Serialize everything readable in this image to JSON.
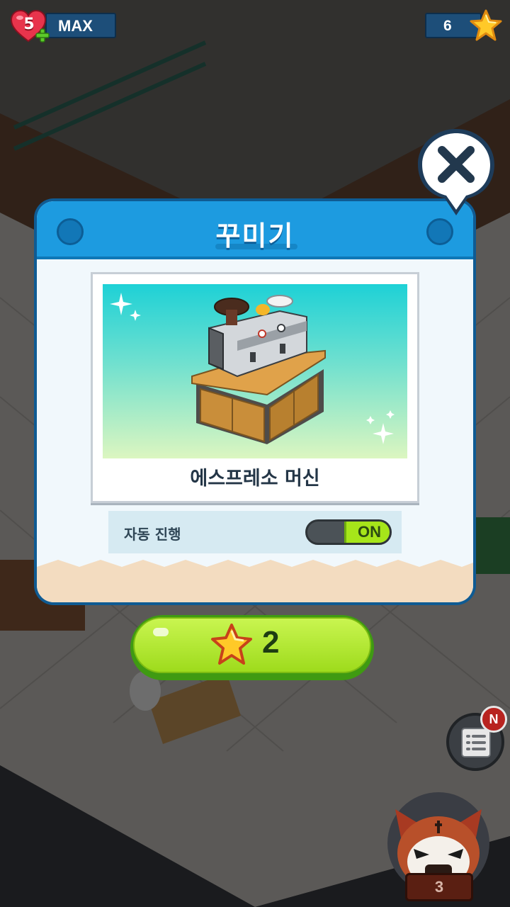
{
  "hud": {
    "hearts_count": "5",
    "hearts_label": "MAX",
    "stars_count": "6"
  },
  "modal": {
    "title": "꾸미기",
    "item_name": "에스프레소 머신",
    "auto_progress_label": "자동 진행",
    "toggle_state": "ON",
    "toggle_on": true
  },
  "purchase": {
    "price": "2",
    "currency_icon": "star-icon"
  },
  "widgets": {
    "notification_badge": "N",
    "character_level": "3"
  },
  "colors": {
    "header_blue": "#1d9be0",
    "buy_green": "#a6e51a",
    "star_yellow": "#ffc928"
  }
}
